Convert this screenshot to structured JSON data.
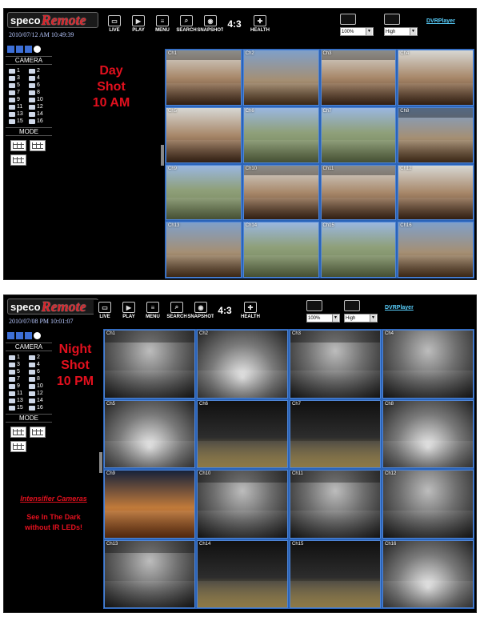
{
  "day": {
    "logo_part1": "speco",
    "logo_part2": "Remote",
    "datetime": "2010/07/12 AM 10:49:39",
    "overlay_lines": [
      "Day",
      "Shot",
      "10 AM"
    ]
  },
  "night": {
    "logo_part1": "speco",
    "logo_part2": "Remote",
    "datetime": "2010/07/08 PM 10:01:07",
    "overlay_lines": [
      "Night",
      "Shot",
      "10 PM"
    ],
    "note_title": "Intensifier Cameras",
    "note_lines": [
      "See In The Dark",
      "without IR LEDs!"
    ]
  },
  "toolbar": {
    "live": "LIVE",
    "play": "PLAY",
    "menu": "MENU",
    "search": "SEARCH",
    "snapshot": "SNAPSHOT",
    "aspect": "4:3",
    "health": "HEALTH"
  },
  "controls": {
    "zoom_value": "100%",
    "quality_value": "High",
    "dvrplayer_link": "DVRPlayer"
  },
  "sidebar": {
    "camera_title": "CAMERA",
    "mode_title": "MODE",
    "cameras": [
      "1",
      "2",
      "3",
      "4",
      "5",
      "6",
      "7",
      "8",
      "9",
      "10",
      "11",
      "12",
      "13",
      "14",
      "15",
      "16"
    ]
  },
  "channels": [
    "Ch1",
    "Ch2",
    "Ch3",
    "Ch4",
    "Ch5",
    "Ch6",
    "Ch7",
    "Ch8",
    "Ch9",
    "Ch10",
    "Ch11",
    "Ch12",
    "Ch13",
    "Ch14",
    "Ch15",
    "Ch16"
  ],
  "colors": {
    "accent_red": "#e3101e",
    "grid_blue": "#2a63b8",
    "link_cyan": "#5ad1ff"
  }
}
